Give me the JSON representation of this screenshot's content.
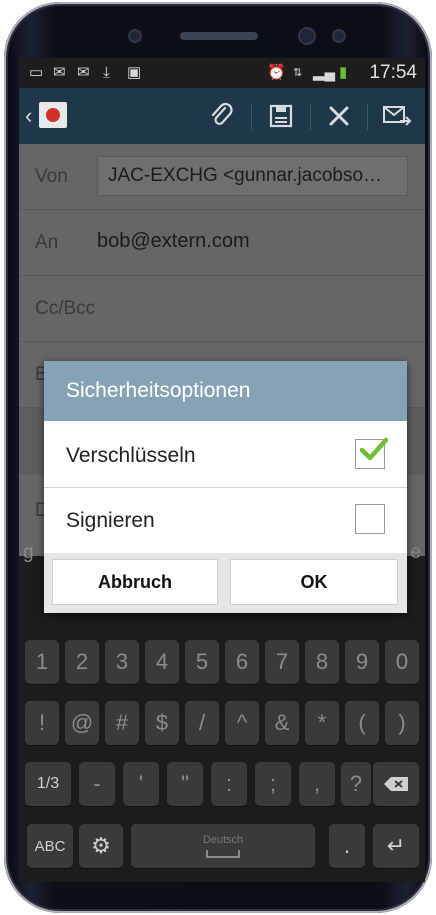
{
  "status_bar": {
    "time": "17:54"
  },
  "compose": {
    "from_label": "Von",
    "from_value": "JAC-EXCHG <gunnar.jacobso…",
    "to_label": "An",
    "to_value": "bob@extern.com",
    "ccbcc_label": "Cc/Bcc",
    "subject_peek": "B",
    "body_peek": "D"
  },
  "dialog": {
    "title": "Sicherheitsoptionen",
    "options": [
      {
        "label": "Verschlüsseln",
        "checked": true
      },
      {
        "label": "Signieren",
        "checked": false
      }
    ],
    "cancel_label": "Abbruch",
    "ok_label": "OK"
  },
  "keyboard": {
    "row_peek_left": "g",
    "row_peek_right": "e",
    "row1": [
      "1",
      "2",
      "3",
      "4",
      "5",
      "6",
      "7",
      "8",
      "9",
      "0"
    ],
    "row2": [
      "!",
      "@",
      "#",
      "$",
      "/",
      "^",
      "&",
      "*",
      "(",
      ")"
    ],
    "row3": [
      "1/3",
      "-",
      "'",
      "\"",
      ":",
      ";",
      ",",
      "?"
    ],
    "mode_label": "ABC",
    "space_label": "Deutsch",
    "period": "."
  },
  "colors": {
    "action_bar": "#1f3849",
    "dialog_title": "#86a3b6",
    "checkmark": "#6cbf2f"
  }
}
